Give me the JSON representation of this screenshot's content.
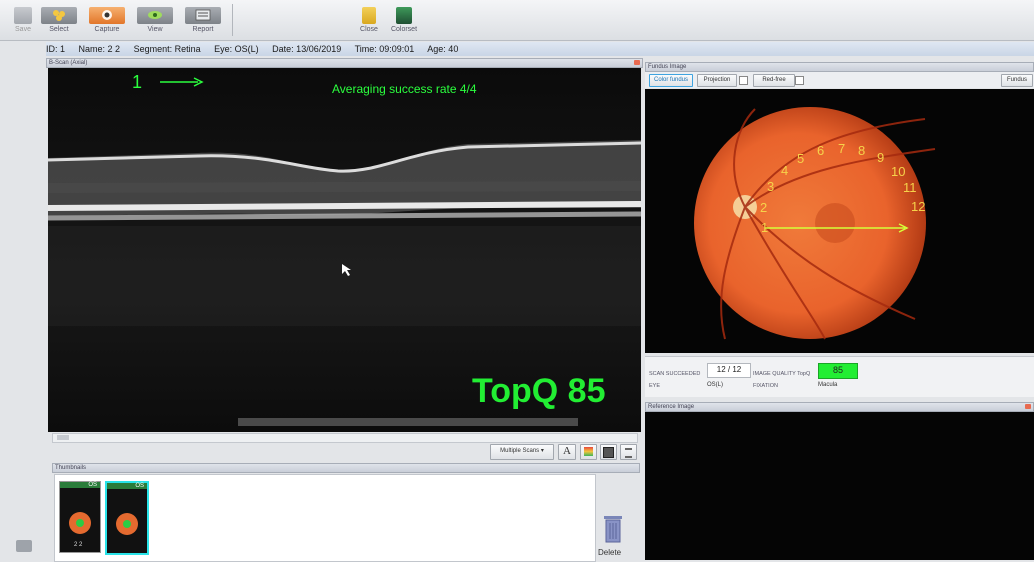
{
  "toolbar": {
    "save": "Save",
    "select": "Select",
    "capture": "Capture",
    "view": "View",
    "report": "Report",
    "close": "Close",
    "colorset": "Colorset"
  },
  "patient": {
    "id": "ID: 1",
    "name": "Name: 2 2",
    "segment": "Segment: Retina",
    "eye": "Eye: OS(L)",
    "date": "Date: 13/06/2019",
    "time": "Time: 09:09:01",
    "age": "Age: 40"
  },
  "bscan": {
    "title": "B-Scan (Axial)",
    "scan_number": "1",
    "averaging": "Averaging success rate  4/4",
    "topq": "TopQ 85",
    "view_select": "Multiple Scans",
    "text_tool": "A"
  },
  "fundus": {
    "title": "Fundus Image",
    "tab_color": "Color fundus",
    "tab_projection": "Projection",
    "tab_redfree": "Red-free",
    "tab_right": "Fundus",
    "scan_numbers": [
      "1",
      "2",
      "3",
      "4",
      "5",
      "6",
      "7",
      "8",
      "9",
      "10",
      "11",
      "12"
    ]
  },
  "scan_info": {
    "scan_succeeded_label": "SCAN SUCCEEDED",
    "scan_succeeded_value": "12 / 12",
    "image_quality_label": "IMAGE QUALITY TopQ",
    "image_quality_value": "85",
    "eye_label": "EYE",
    "eye_value": "OS(L)",
    "fixation_label": "FIXATION",
    "fixation_value": "Macula"
  },
  "reference": {
    "title": "Reference Image"
  },
  "thumbnails": {
    "title": "Thumbnails",
    "items": [
      {
        "label": "OS",
        "caption": "2 2"
      },
      {
        "label": "OS",
        "caption": ""
      }
    ]
  },
  "delete_label": "Delete",
  "colors": {
    "accent_green": "#2bff3e",
    "fundus_orange": "#e9632c",
    "topq_badge": "#22ee33",
    "capture_active": "#e97c31"
  }
}
